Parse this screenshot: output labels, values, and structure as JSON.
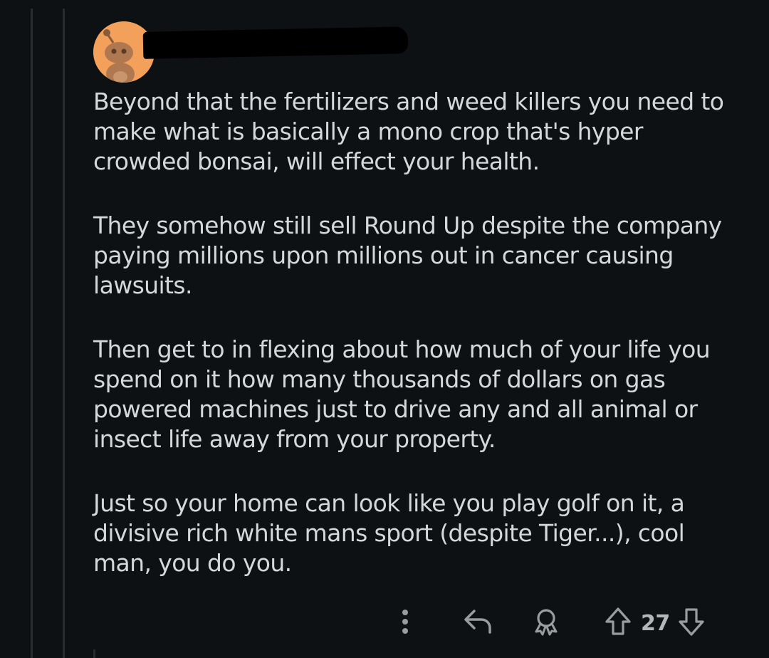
{
  "comment": {
    "avatar_icon": "snoo-avatar-icon",
    "username": "",
    "paragraphs": [
      "Beyond that the fertilizers and weed killers you need to\nmake what is basically a mono crop that's hyper\ncrowded bonsai, will effect your health.",
      "They somehow still sell Round Up despite the company\npaying millions upon millions out in cancer causing\nlawsuits.",
      "Then get to in flexing about how much of your life you\nspend on it how many thousands of dollars on gas\npowered machines just to drive any and all animal or\ninsect life away from your property.",
      "Just so your home can look like you play golf on it, a\ndivisive rich white mans sport (despite Tiger...), cool\nman, you do you."
    ]
  },
  "actions": {
    "more_icon": "more-vertical-icon",
    "reply_icon": "reply-icon",
    "award_icon": "award-icon",
    "upvote_icon": "upvote-arrow-icon",
    "vote_count": "27",
    "downvote_icon": "downvote-arrow-icon"
  },
  "colors": {
    "background": "#0e1114",
    "text": "#d5d8da",
    "icon": "#9a9da0",
    "avatar": "#f2a05a"
  }
}
